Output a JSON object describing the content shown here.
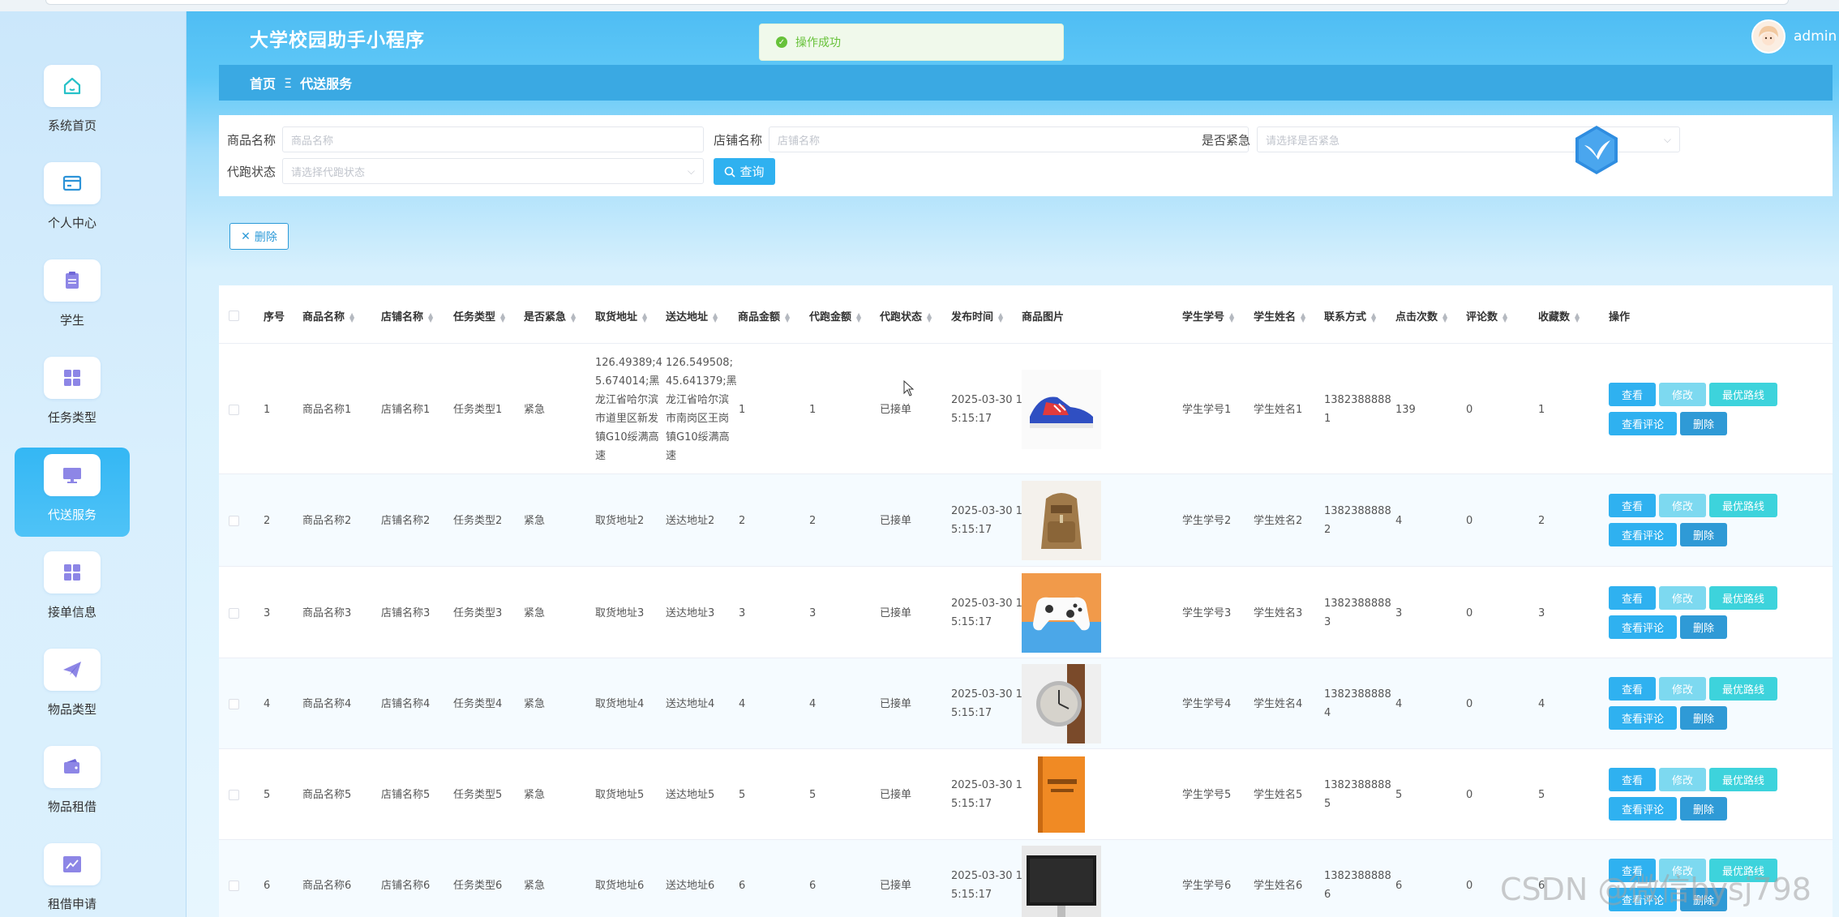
{
  "app": {
    "title": "大学校园助手小程序",
    "user": "admin",
    "toast": "操作成功"
  },
  "breadcrumb": {
    "home": "首页",
    "separator": "Ξ",
    "current": "代送服务"
  },
  "sidebar": {
    "items": [
      {
        "label": "系统首页",
        "icon": "home-icon",
        "active": false
      },
      {
        "label": "个人中心",
        "icon": "wallet-icon",
        "active": false
      },
      {
        "label": "学生",
        "icon": "clipboard-icon",
        "active": false
      },
      {
        "label": "任务类型",
        "icon": "grid-icon",
        "active": false
      },
      {
        "label": "代送服务",
        "icon": "monitor-icon",
        "active": true
      },
      {
        "label": "接单信息",
        "icon": "grid-icon",
        "active": false
      },
      {
        "label": "物品类型",
        "icon": "send-icon",
        "active": false
      },
      {
        "label": "物品租借",
        "icon": "purse-icon",
        "active": false
      },
      {
        "label": "租借申请",
        "icon": "chart-icon",
        "active": false
      }
    ]
  },
  "search": {
    "product_label": "商品名称",
    "product_placeholder": "商品名称",
    "shop_label": "店铺名称",
    "shop_placeholder": "店铺名称",
    "urgent_label": "是否紧急",
    "urgent_placeholder": "请选择是否紧急",
    "status_label": "代跑状态",
    "status_placeholder": "请选择代跑状态",
    "query_button": "查询"
  },
  "toolbar": {
    "delete_button": "删除"
  },
  "table": {
    "columns": [
      "序号",
      "商品名称",
      "店铺名称",
      "任务类型",
      "是否紧急",
      "取货地址",
      "送达地址",
      "商品金额",
      "代跑金额",
      "代跑状态",
      "发布时间",
      "商品图片",
      "学生学号",
      "学生姓名",
      "联系方式",
      "点击次数",
      "评论数",
      "收藏数",
      "操作"
    ],
    "actions": {
      "view": "查看",
      "edit": "修改",
      "route": "最优路线",
      "review": "查看评论",
      "delete": "删除"
    },
    "rows": [
      {
        "no": "1",
        "name": "商品名称1",
        "shop": "店铺名称1",
        "type": "任务类型1",
        "urgent": "紧急",
        "pickup": [
          "126.49389;4",
          "5.674014;黑",
          "龙江省哈尔滨",
          "市道里区新发",
          "镇G10绥满高",
          "速"
        ],
        "deliver": [
          "126.549508;",
          "45.641379;黑",
          "龙江省哈尔滨",
          "市南岗区王岗",
          "镇G10绥满高",
          "速"
        ],
        "amount": "1",
        "fee": "1",
        "status": "已接单",
        "time": [
          "2025-03-30 1",
          "5:15:17"
        ],
        "image": "sneaker",
        "sid": "学生学号1",
        "sname": "学生姓名1",
        "phone": [
          "1382388888",
          "1"
        ],
        "clicks": "139",
        "comments": "0",
        "favs": "1"
      },
      {
        "no": "2",
        "name": "商品名称2",
        "shop": "店铺名称2",
        "type": "任务类型2",
        "urgent": "紧急",
        "pickup": [
          "取货地址2"
        ],
        "deliver": [
          "送达地址2"
        ],
        "amount": "2",
        "fee": "2",
        "status": "已接单",
        "time": [
          "2025-03-30 1",
          "5:15:17"
        ],
        "image": "backpack",
        "sid": "学生学号2",
        "sname": "学生姓名2",
        "phone": [
          "1382388888",
          "2"
        ],
        "clicks": "4",
        "comments": "0",
        "favs": "2"
      },
      {
        "no": "3",
        "name": "商品名称3",
        "shop": "店铺名称3",
        "type": "任务类型3",
        "urgent": "紧急",
        "pickup": [
          "取货地址3"
        ],
        "deliver": [
          "送达地址3"
        ],
        "amount": "3",
        "fee": "3",
        "status": "已接单",
        "time": [
          "2025-03-30 1",
          "5:15:17"
        ],
        "image": "gamepad",
        "sid": "学生学号3",
        "sname": "学生姓名3",
        "phone": [
          "1382388888",
          "3"
        ],
        "clicks": "3",
        "comments": "0",
        "favs": "3"
      },
      {
        "no": "4",
        "name": "商品名称4",
        "shop": "店铺名称4",
        "type": "任务类型4",
        "urgent": "紧急",
        "pickup": [
          "取货地址4"
        ],
        "deliver": [
          "送达地址4"
        ],
        "amount": "4",
        "fee": "4",
        "status": "已接单",
        "time": [
          "2025-03-30 1",
          "5:15:17"
        ],
        "image": "watch",
        "sid": "学生学号4",
        "sname": "学生姓名4",
        "phone": [
          "1382388888",
          "4"
        ],
        "clicks": "4",
        "comments": "0",
        "favs": "4"
      },
      {
        "no": "5",
        "name": "商品名称5",
        "shop": "店铺名称5",
        "type": "任务类型5",
        "urgent": "紧急",
        "pickup": [
          "取货地址5"
        ],
        "deliver": [
          "送达地址5"
        ],
        "amount": "5",
        "fee": "5",
        "status": "已接单",
        "time": [
          "2025-03-30 1",
          "5:15:17"
        ],
        "image": "book",
        "sid": "学生学号5",
        "sname": "学生姓名5",
        "phone": [
          "1382388888",
          "5"
        ],
        "clicks": "5",
        "comments": "0",
        "favs": "5"
      },
      {
        "no": "6",
        "name": "商品名称6",
        "shop": "店铺名称6",
        "type": "任务类型6",
        "urgent": "紧急",
        "pickup": [
          "取货地址6"
        ],
        "deliver": [
          "送达地址6"
        ],
        "amount": "6",
        "fee": "6",
        "status": "已接单",
        "time": [
          "2025-03-30 1",
          "5:15:17"
        ],
        "image": "monitor",
        "sid": "学生学号6",
        "sname": "学生姓名6",
        "phone": [
          "1382388888",
          "6"
        ],
        "clicks": "6",
        "comments": "0",
        "favs": "6"
      }
    ]
  },
  "watermark": "CSDN @微信bysj798",
  "colors": {
    "primary": "#2fb1f0",
    "header": "#4fbdf3",
    "breadcrumb": "#3aa9e3",
    "success": "#67c23a"
  }
}
